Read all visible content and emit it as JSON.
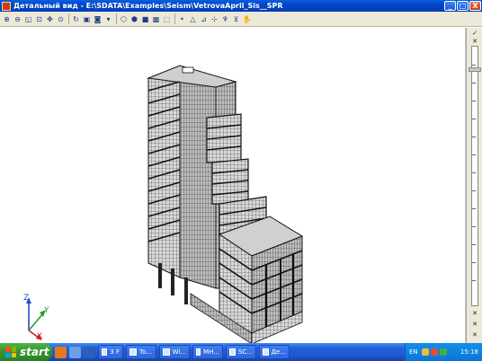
{
  "window": {
    "title": "Детальный вид - E:\\SDATA\\Examples\\Seism\\VetrovaApril_Sis__SPR",
    "buttons": {
      "minimize": "_",
      "maximize": "□",
      "close": "X"
    }
  },
  "toolbar": {
    "tools": [
      {
        "name": "zoom-in-icon",
        "glyph": "⊕"
      },
      {
        "name": "zoom-out-icon",
        "glyph": "⊖"
      },
      {
        "name": "zoom-window-icon",
        "glyph": "◱"
      },
      {
        "name": "zoom-all-icon",
        "glyph": "⊡"
      },
      {
        "name": "pan-icon",
        "glyph": "✥"
      },
      {
        "name": "zoom-previous-icon",
        "glyph": "⊙"
      },
      {
        "name": "rotate-icon",
        "glyph": "↻"
      },
      {
        "name": "view-icon",
        "glyph": "▣"
      },
      {
        "name": "camera-icon",
        "glyph": "◙"
      },
      {
        "name": "dropdown-arrow-icon",
        "glyph": "▾"
      },
      {
        "name": "render-cube-icon",
        "glyph": "⬡"
      },
      {
        "name": "wire-cube-icon",
        "glyph": "⬢"
      },
      {
        "name": "solid-cube-icon",
        "glyph": "■"
      },
      {
        "name": "shaded-cube-icon",
        "glyph": "▩"
      },
      {
        "name": "section-icon",
        "glyph": "⬚"
      },
      {
        "name": "point-icon",
        "glyph": "•"
      },
      {
        "name": "triangle-icon",
        "glyph": "△"
      },
      {
        "name": "measure-icon",
        "glyph": "⊿"
      },
      {
        "name": "axes-icon",
        "glyph": "⊹"
      },
      {
        "name": "tree-icon",
        "glyph": "♆"
      },
      {
        "name": "filter-icon",
        "glyph": "⊻"
      },
      {
        "name": "hand-icon",
        "glyph": "✋"
      }
    ]
  },
  "axes": {
    "z": "Z",
    "y": "Y",
    "x": "X"
  },
  "right_toolbar": {
    "top_buttons": [
      "✓",
      "✕"
    ],
    "bottom_buttons": [
      "✕",
      "✕",
      "✕"
    ]
  },
  "taskbar": {
    "start_label": "start",
    "tasks": [
      {
        "label": "3 F",
        "name": "task-folder"
      },
      {
        "label": "To...",
        "name": "task-total-commander"
      },
      {
        "label": "Wi...",
        "name": "task-windows"
      },
      {
        "label": "MH...",
        "name": "task-mh"
      },
      {
        "label": "SC...",
        "name": "task-scad"
      },
      {
        "label": "Де...",
        "name": "task-detail-view"
      }
    ],
    "tray": {
      "language": "EN",
      "time": "15:18"
    }
  },
  "colors": {
    "titlebar": "#0046c8",
    "start": "#35922f",
    "axis_z": "#1d4fd0",
    "axis_y": "#2d9a2d",
    "axis_x": "#d02020"
  }
}
